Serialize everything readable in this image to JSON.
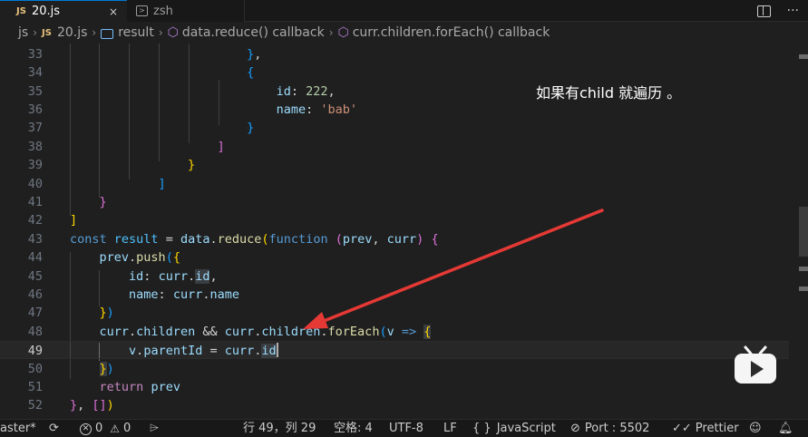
{
  "tabs": {
    "active": {
      "badge": "JS",
      "label": "20.js",
      "close": "×"
    },
    "inactive": {
      "label": "zsh"
    }
  },
  "breadcrumbs": {
    "folder": "js",
    "file_badge": "JS",
    "file": "20.js",
    "symbol1": "result",
    "symbol2": "data.reduce() callback",
    "symbol3": "curr.children.forEach() callback",
    "separator": "›"
  },
  "editor": {
    "line_numbers": [
      "33",
      "34",
      "35",
      "36",
      "37",
      "38",
      "39",
      "40",
      "41",
      "42",
      "43",
      "44",
      "45",
      "46",
      "47",
      "48",
      "49",
      "50",
      "51",
      "52"
    ],
    "active_line": 17
  },
  "annotation": {
    "text": "如果有child 就遍历 。"
  },
  "status": {
    "branch": "aster*",
    "errors": "0",
    "warnings": "0",
    "position": "行 49，列 29",
    "spaces": "空格: 4",
    "encoding": "UTF-8",
    "eol": "LF",
    "language": "JavaScript",
    "language_prefix": "{ }",
    "port": "Port : 5502",
    "prettier": "Prettier"
  },
  "colors": {
    "accent": "#0078d4",
    "arrow": "#e53935",
    "logo": "#f5f5f5"
  }
}
